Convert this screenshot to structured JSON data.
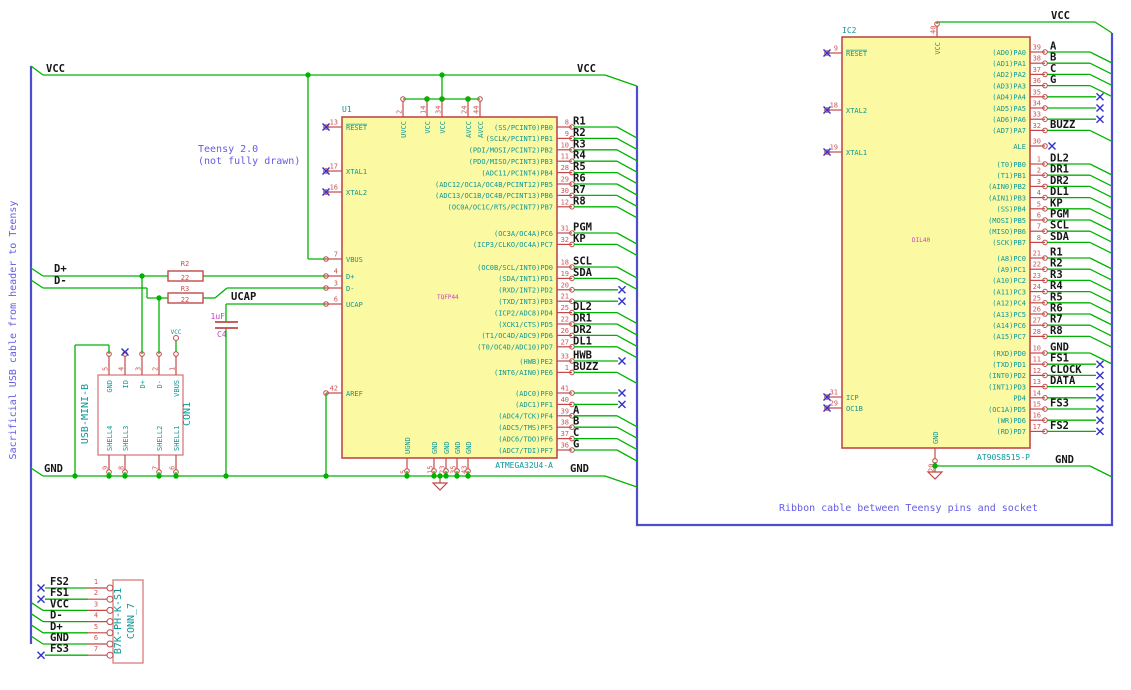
{
  "notes": {
    "left_bus": "Sacrificial USB cable from header to Teensy",
    "teensy1": "Teensy 2.0",
    "teensy2": "(not fully drawn)",
    "ribbon": "Ribbon cable between Teensy pins and socket"
  },
  "labels": {
    "vcc": "VCC",
    "gnd": "GND",
    "dp": "D+",
    "dm": "D-",
    "ucap": "UCAP"
  },
  "r2": {
    "ref": "R2",
    "value": "22"
  },
  "r3": {
    "ref": "R3",
    "value": "22"
  },
  "c4": {
    "ref": "C4",
    "value": "1uF"
  },
  "u1": {
    "ref": "U1",
    "value": "ATMEGA32U4-A",
    "footprint": "TQFP44",
    "left_pins": [
      {
        "n": "13",
        "name": "RESET",
        "bar": true,
        "nc": true
      },
      {
        "n": "17",
        "name": "XTAL1",
        "nc": true
      },
      {
        "n": "16",
        "name": "XTAL2",
        "nc": true
      },
      {
        "n": "7",
        "name": "VBUS"
      },
      {
        "n": "4",
        "name": "D+"
      },
      {
        "n": "3",
        "name": "D-"
      },
      {
        "n": "6",
        "name": "UCAP"
      },
      {
        "n": "42",
        "name": "AREF"
      }
    ],
    "top_pins": [
      {
        "n": "2",
        "name": "UVCC"
      },
      {
        "n": "14",
        "name": "VCC"
      },
      {
        "n": "34",
        "name": "VCC"
      },
      {
        "n": "24",
        "name": "AVCC"
      },
      {
        "n": "44",
        "name": "AVCC"
      }
    ],
    "bottom_pins": [
      {
        "n": "5",
        "name": "UGND"
      },
      {
        "n": "15",
        "name": "GND"
      },
      {
        "n": "23",
        "name": "GND"
      },
      {
        "n": "35",
        "name": "GND"
      },
      {
        "n": "43",
        "name": "GND"
      }
    ],
    "right_groups": [
      {
        "pins": [
          {
            "n": "8",
            "name": "(SS/PCINT0)PB0",
            "net": "R1"
          },
          {
            "n": "9",
            "name": "(SCLK/PCINT1)PB1",
            "net": "R2"
          },
          {
            "n": "10",
            "name": "(PDI/MOSI/PCINT2)PB2",
            "net": "R3"
          },
          {
            "n": "11",
            "name": "(PDO/MISO/PCINT3)PB3",
            "net": "R4"
          },
          {
            "n": "28",
            "name": "(ADC11/PCINT4)PB4",
            "net": "R5"
          },
          {
            "n": "29",
            "name": "(ADC12/OC1A/OC4B/PCINT12)PB5",
            "net": "R6"
          },
          {
            "n": "30",
            "name": "(ADC13/OC1B/OC4B/PCINT13)PB6",
            "net": "R7"
          },
          {
            "n": "12",
            "name": "(OC0A/OC1C/RTS/PCINT7)PB7",
            "net": "R8"
          }
        ]
      },
      {
        "pins": [
          {
            "n": "31",
            "name": "(OC3A/OC4A)PC6",
            "net": "PGM"
          },
          {
            "n": "32",
            "name": "(ICP3/CLKO/OC4A)PC7",
            "net": "KP"
          }
        ]
      },
      {
        "pins": [
          {
            "n": "18",
            "name": "(OC0B/SCL/INT0)PD0",
            "net": "SCL"
          },
          {
            "n": "19",
            "name": "(SDA/INT1)PD1",
            "net": "SDA"
          },
          {
            "n": "20",
            "name": "(RXD/INT2)PD2",
            "nc": true
          },
          {
            "n": "21",
            "name": "(TXD/INT3)PD3",
            "nc": true
          },
          {
            "n": "25",
            "name": "(ICP2/ADC8)PD4",
            "net": "DL2"
          },
          {
            "n": "22",
            "name": "(XCK1/CTS)PD5",
            "net": "DR1"
          },
          {
            "n": "26",
            "name": "(T1/OC4D/ADC9)PD6",
            "net": "DR2"
          },
          {
            "n": "27",
            "name": "(T0/OC4D/ADC10)PD7",
            "net": "DL1"
          }
        ]
      },
      {
        "pins": [
          {
            "n": "33",
            "name": "(HWB)PE2",
            "net": "HWB",
            "nc": true
          },
          {
            "n": "1",
            "name": "(INT6/AIN0)PE6",
            "net": "BUZZ"
          }
        ]
      },
      {
        "pins": [
          {
            "n": "41",
            "name": "(ADC0)PF0",
            "nc": true
          },
          {
            "n": "40",
            "name": "(ADC1)PF1",
            "nc": true
          },
          {
            "n": "39",
            "name": "(ADC4/TCK)PF4",
            "net": "A"
          },
          {
            "n": "38",
            "name": "(ADC5/TMS)PF5",
            "net": "B"
          },
          {
            "n": "37",
            "name": "(ADC6/TDO)PF6",
            "net": "C"
          },
          {
            "n": "36",
            "name": "(ADC7/TDI)PF7",
            "net": "G"
          }
        ]
      }
    ]
  },
  "ic2": {
    "ref": "IC2",
    "value": "AT90S8515-P",
    "footprint": "DIL40",
    "left_pins": [
      {
        "n": "9",
        "name": "RESET",
        "bar": true,
        "nc": true
      },
      {
        "n": "18",
        "name": "XTAL2",
        "nc": true
      },
      {
        "n": "19",
        "name": "XTAL1",
        "nc": true
      },
      {
        "n": "31",
        "name": "ICP",
        "nc": true
      },
      {
        "n": "29",
        "name": "OC1B",
        "nc": true
      }
    ],
    "top_pins": [
      {
        "n": "40",
        "name": "VCC"
      }
    ],
    "bottom_pins": [
      {
        "n": "20",
        "name": "GND"
      }
    ],
    "right_groups": [
      {
        "pins": [
          {
            "n": "39",
            "name": "(AD0)PA0",
            "net": "A"
          },
          {
            "n": "38",
            "name": "(AD1)PA1",
            "net": "B"
          },
          {
            "n": "37",
            "name": "(AD2)PA2",
            "net": "C"
          },
          {
            "n": "36",
            "name": "(AD3)PA3",
            "net": "G"
          },
          {
            "n": "35",
            "name": "(AD4)PA4",
            "nc": true
          },
          {
            "n": "34",
            "name": "(AD5)PA5",
            "nc": true
          },
          {
            "n": "33",
            "name": "(AD6)PA6",
            "nc": true
          },
          {
            "n": "32",
            "name": "(AD7)PA7",
            "net": "BUZZ"
          }
        ]
      },
      {
        "pins": [
          {
            "n": "30",
            "name": "ALE",
            "nc": true
          }
        ]
      },
      {
        "pins": [
          {
            "n": "1",
            "name": "(T0)PB0",
            "net": "DL2"
          },
          {
            "n": "2",
            "name": "(T1)PB1",
            "net": "DR1"
          },
          {
            "n": "3",
            "name": "(AIN0)PB2",
            "net": "DR2"
          },
          {
            "n": "4",
            "name": "(AIN1)PB3",
            "net": "DL1"
          },
          {
            "n": "5",
            "name": "(SS)PB4",
            "net": "KP"
          },
          {
            "n": "6",
            "name": "(MOSI)PB5",
            "net": "PGM"
          },
          {
            "n": "7",
            "name": "(MISO)PB6",
            "net": "SCL"
          },
          {
            "n": "8",
            "name": "(SCK)PB7",
            "net": "SDA"
          }
        ]
      },
      {
        "pins": [
          {
            "n": "21",
            "name": "(A8)PC0",
            "net": "R1"
          },
          {
            "n": "22",
            "name": "(A9)PC1",
            "net": "R2"
          },
          {
            "n": "23",
            "name": "(A10)PC2",
            "net": "R3"
          },
          {
            "n": "24",
            "name": "(A11)PC3",
            "net": "R4"
          },
          {
            "n": "25",
            "name": "(A12)PC4",
            "net": "R5"
          },
          {
            "n": "26",
            "name": "(A13)PC5",
            "net": "R6"
          },
          {
            "n": "27",
            "name": "(A14)PC6",
            "net": "R7"
          },
          {
            "n": "28",
            "name": "(A15)PC7",
            "net": "R8"
          }
        ]
      },
      {
        "pins": [
          {
            "n": "10",
            "name": "(RXD)PD0",
            "net": "GND"
          },
          {
            "n": "11",
            "name": "(TXD)PD1",
            "net": "FS1",
            "nc": true
          },
          {
            "n": "12",
            "name": "(INT0)PD2",
            "net": "CLOCK",
            "nc": true
          },
          {
            "n": "13",
            "name": "(INT1)PD3",
            "net": "DATA",
            "nc": true
          },
          {
            "n": "14",
            "name": "PD4",
            "nc": true
          },
          {
            "n": "15",
            "name": "(OC1A)PD5",
            "net": "FS3",
            "nc": true
          },
          {
            "n": "16",
            "name": "(WR)PD6",
            "nc": true
          },
          {
            "n": "17",
            "name": "(RD)PD7",
            "net": "FS2",
            "nc": true
          }
        ]
      }
    ]
  },
  "con1": {
    "ref": "CON1",
    "value": "USB-MINI-B",
    "top_pins": [
      {
        "n": "5",
        "name": "GND"
      },
      {
        "n": "4",
        "name": "ID",
        "nc": true
      },
      {
        "n": "3",
        "name": "D+"
      },
      {
        "n": "2",
        "name": "D-"
      },
      {
        "n": "1",
        "name": "VBUS"
      }
    ],
    "bottom_pins": [
      {
        "n": "9",
        "name": "SHELL4"
      },
      {
        "n": "8",
        "name": "SHELL3"
      },
      {
        "n": "7",
        "name": "SHELL2"
      },
      {
        "n": "6",
        "name": "SHELL1"
      }
    ]
  },
  "conn7": {
    "ref": "CONN_7",
    "value": "B7K-PH-K-S1",
    "pins": [
      {
        "n": "1",
        "net": "FS2",
        "nc": true
      },
      {
        "n": "2",
        "net": "FS1",
        "nc": true
      },
      {
        "n": "3",
        "net": "VCC"
      },
      {
        "n": "4",
        "net": "D-"
      },
      {
        "n": "5",
        "net": "D+"
      },
      {
        "n": "6",
        "net": "GND"
      },
      {
        "n": "7",
        "net": "FS3",
        "nc": true
      }
    ]
  }
}
